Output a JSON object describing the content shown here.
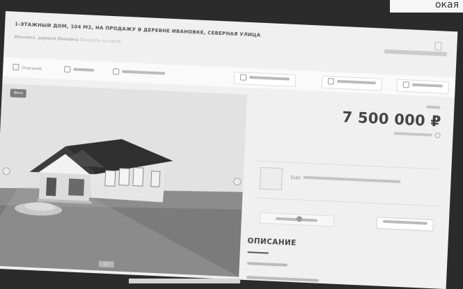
{
  "corner_text": "окая",
  "listing": {
    "title": "1-ЭТАЖНЫЙ ДОМ, 104 М2, НА ПРОДАЖУ В ДЕРЕВНЕ ИВАНОВКЕ, СЕВЕРНАЯ УЛИЦА",
    "address": "Ивановка, деревня Ивановка",
    "map_link": "Показать на карте"
  },
  "toolbar": {
    "first_label": "Описание"
  },
  "photo": {
    "badge": "Фото",
    "counter": "1/12"
  },
  "sidebar": {
    "price": "7 500 000 ₽",
    "agency_name": "ЕЦН"
  },
  "description": {
    "title": "ОПИСАНИЕ"
  },
  "colors": {
    "page_bg": "#f0f0f0",
    "surround": "#2b2b2b",
    "text_dark": "#444444"
  }
}
